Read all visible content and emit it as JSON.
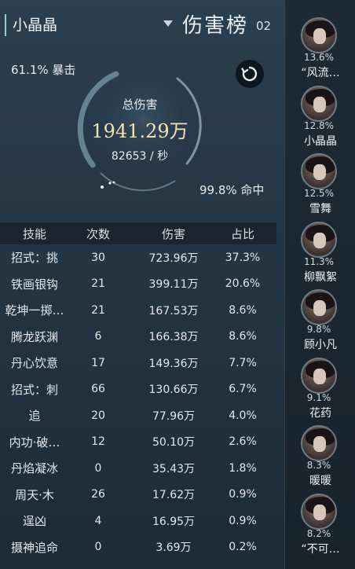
{
  "header": {
    "player_name": "小晶晶",
    "title": "伤害榜",
    "page_num": "02"
  },
  "stats": {
    "crit": "61.1% 暴击",
    "hit": "99.8% 命中",
    "total_label": "总伤害",
    "total_value": "1941.29万",
    "rate": "82653 / 秒"
  },
  "table": {
    "headers": [
      "技能",
      "次数",
      "伤害",
      "占比"
    ],
    "rows": [
      [
        "招式：挑",
        "30",
        "723.96万",
        "37.3%"
      ],
      [
        "铁画银钩",
        "21",
        "399.11万",
        "20.6%"
      ],
      [
        "乾坤一掷…",
        "21",
        "167.53万",
        "8.6%"
      ],
      [
        "腾龙跃渊",
        "6",
        "166.38万",
        "8.6%"
      ],
      [
        "丹心饮意",
        "17",
        "149.36万",
        "7.7%"
      ],
      [
        "招式：刺",
        "66",
        "130.66万",
        "6.7%"
      ],
      [
        "追",
        "20",
        "77.96万",
        "4.0%"
      ],
      [
        "内功·破…",
        "12",
        "50.10万",
        "2.6%"
      ],
      [
        "丹焰凝冰",
        "0",
        "35.43万",
        "1.8%"
      ],
      [
        "周天·木",
        "26",
        "17.62万",
        "0.9%"
      ],
      [
        "逞凶",
        "4",
        "16.95万",
        "0.9%"
      ],
      [
        "摄神追命",
        "0",
        "3.69万",
        "0.2%"
      ]
    ]
  },
  "ranking": [
    {
      "pct": "13.6%",
      "name": "“风流…"
    },
    {
      "pct": "12.8%",
      "name": "小晶晶"
    },
    {
      "pct": "12.5%",
      "name": "雪舞"
    },
    {
      "pct": "11.3%",
      "name": "柳飘絮"
    },
    {
      "pct": "9.8%",
      "name": "顾小凡"
    },
    {
      "pct": "9.1%",
      "name": "花药"
    },
    {
      "pct": "8.3%",
      "name": "暖暖"
    },
    {
      "pct": "8.2%",
      "name": "“不可…"
    }
  ],
  "icons": {
    "reset": "refresh-icon",
    "title_caret": "caret-down-icon"
  },
  "colors": {
    "background": "#243543",
    "total_value": "#f2e3b5",
    "table_header_bg": "#1a2530"
  }
}
